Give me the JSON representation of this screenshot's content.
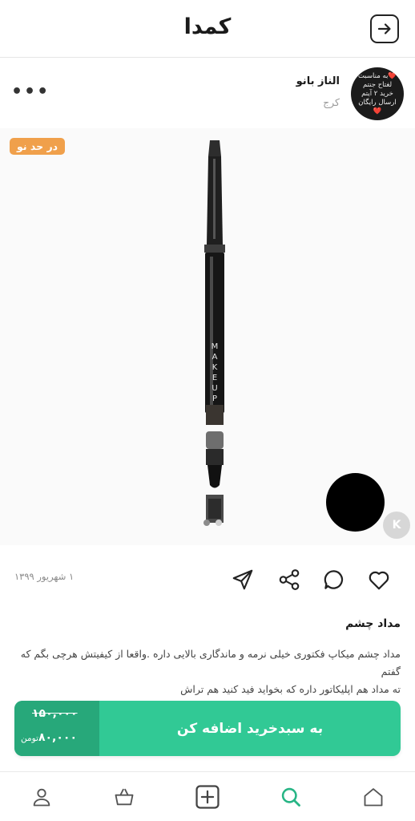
{
  "header": {
    "logo": "کمدا"
  },
  "seller": {
    "name": "الناز بانو",
    "city": "کرج",
    "avatar_text": "❤️به مناسبت لغتاح جنتم خرید ۲ آیتم ارسال رایگان❤️"
  },
  "product": {
    "condition_badge": "در حد نو",
    "watermark": "K",
    "image_count": 2,
    "active_image": 1,
    "date": "۱ شهریور ۱۳۹۹",
    "title": "مداد چشم",
    "description": [
      "مداد چشم میکاپ فکتوری خیلی نرمه و ماندگاری بالایی داره .واقعا از کیفیتش هرچی بگم که گفتم",
      "ته مداد هم اپلیکاتور داره که بخواید فید کنید هم تراش"
    ]
  },
  "cta": {
    "label": "به سبدخرید اضافه کن",
    "old_price": "۱۵۰,۰۰۰",
    "new_price": "۸۰,۰۰۰",
    "currency": "تومن"
  },
  "colors": {
    "accent": "#31c995",
    "accent_dark": "#27a87a",
    "badge": "#f0a04b",
    "swatch": "#000000"
  },
  "bottom_nav": [
    "profile-icon",
    "basket-icon",
    "add-icon",
    "search-icon",
    "home-icon"
  ]
}
